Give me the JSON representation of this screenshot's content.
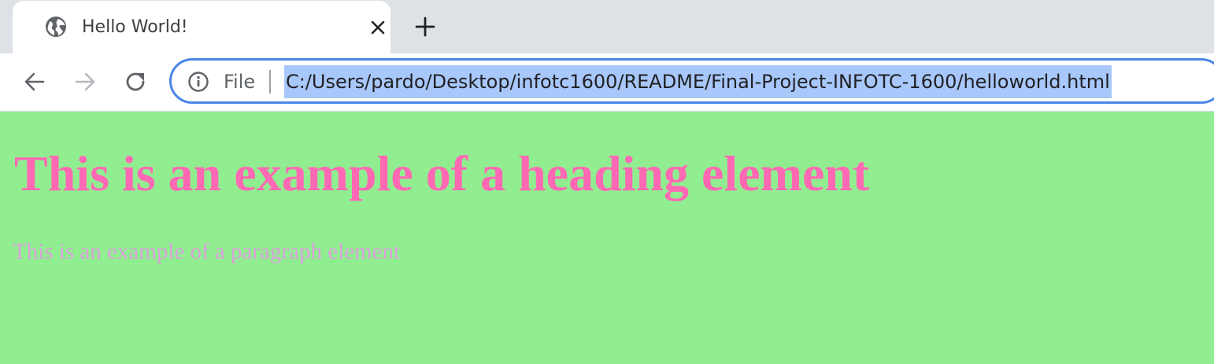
{
  "browser": {
    "tab": {
      "title": "Hello World!",
      "favicon": "globe-icon",
      "close_icon": "close-icon"
    },
    "new_tab_icon": "plus-icon",
    "nav": {
      "back_icon": "arrow-left-icon",
      "forward_icon": "arrow-right-icon",
      "reload_icon": "reload-icon"
    },
    "omnibox": {
      "security_icon": "info-icon",
      "scheme_label": "File",
      "url": "C:/Users/pardo/Desktop/infotc1600/README/Final-Project-INFOTC-1600/helloworld.html",
      "url_selected": true
    }
  },
  "page": {
    "background_color": "#90ee90",
    "heading": "This is an example of a heading element",
    "heading_color": "#ff69b4",
    "paragraph": "This is an example of a paragraph element",
    "paragraph_color": "#dda0dd"
  },
  "colors": {
    "tabstrip": "#dee1e6",
    "focus_ring": "#4a86e8",
    "selection": "#a8c7fa"
  }
}
